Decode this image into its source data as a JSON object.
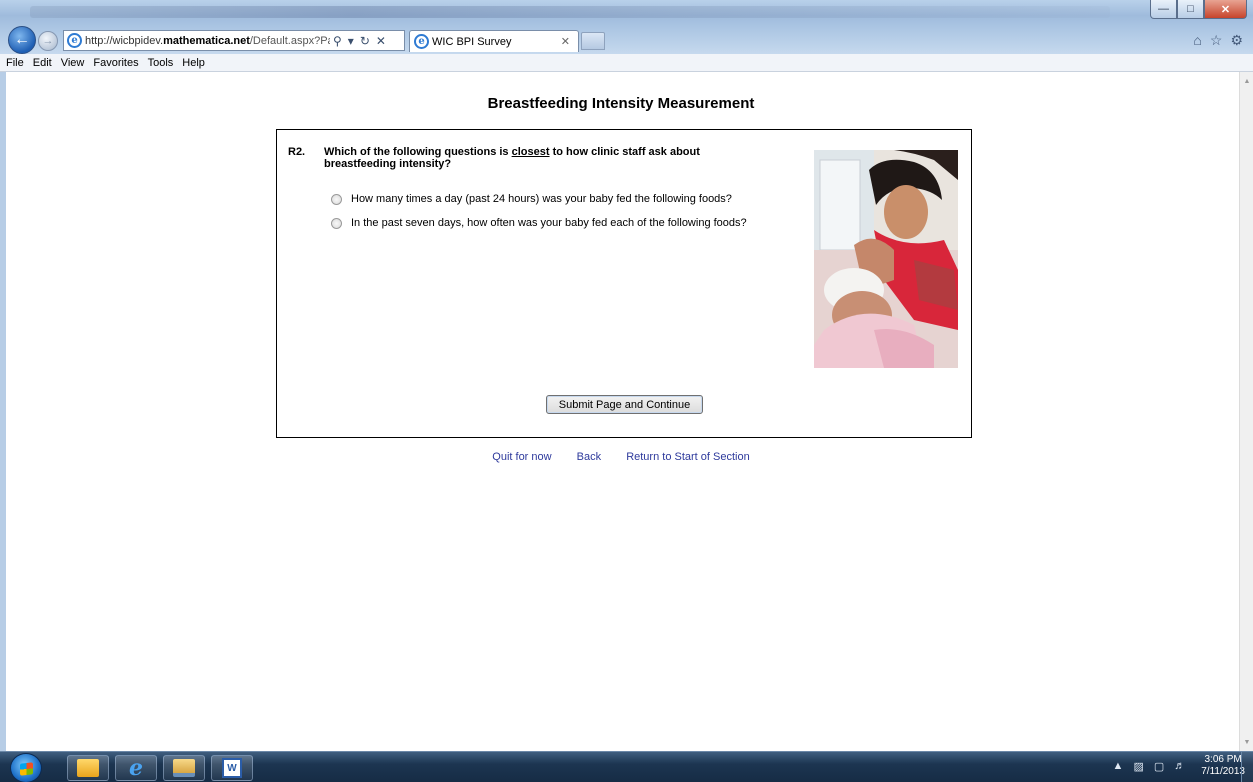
{
  "browser": {
    "url_prefix": "http://wicbpidev.",
    "url_domain": "mathematica.net",
    "url_suffix": "/Default.aspx?Page=!",
    "tab_title": "WIC BPI Survey",
    "menu": [
      "File",
      "Edit",
      "View",
      "Favorites",
      "Tools",
      "Help"
    ]
  },
  "page": {
    "title": "Breastfeeding Intensity Measurement",
    "question": {
      "number": "R2.",
      "text_before": "Which of the following questions is ",
      "text_emphasis": "closest",
      "text_after": " to how clinic staff ask about breastfeeding intensity?",
      "options": [
        "How many times a day (past 24 hours) was your baby fed the following foods?",
        "In the past seven days, how often was your baby fed each of the following foods?"
      ]
    },
    "submit_label": "Submit Page and Continue",
    "links": {
      "quit": "Quit for now",
      "back": "Back",
      "return": "Return to Start of Section"
    }
  },
  "taskbar": {
    "time": "3:06 PM",
    "date": "7/11/2013"
  },
  "colors": {
    "link": "#2e3a9c",
    "border": "#000000",
    "taskbar": "#1c3551"
  }
}
